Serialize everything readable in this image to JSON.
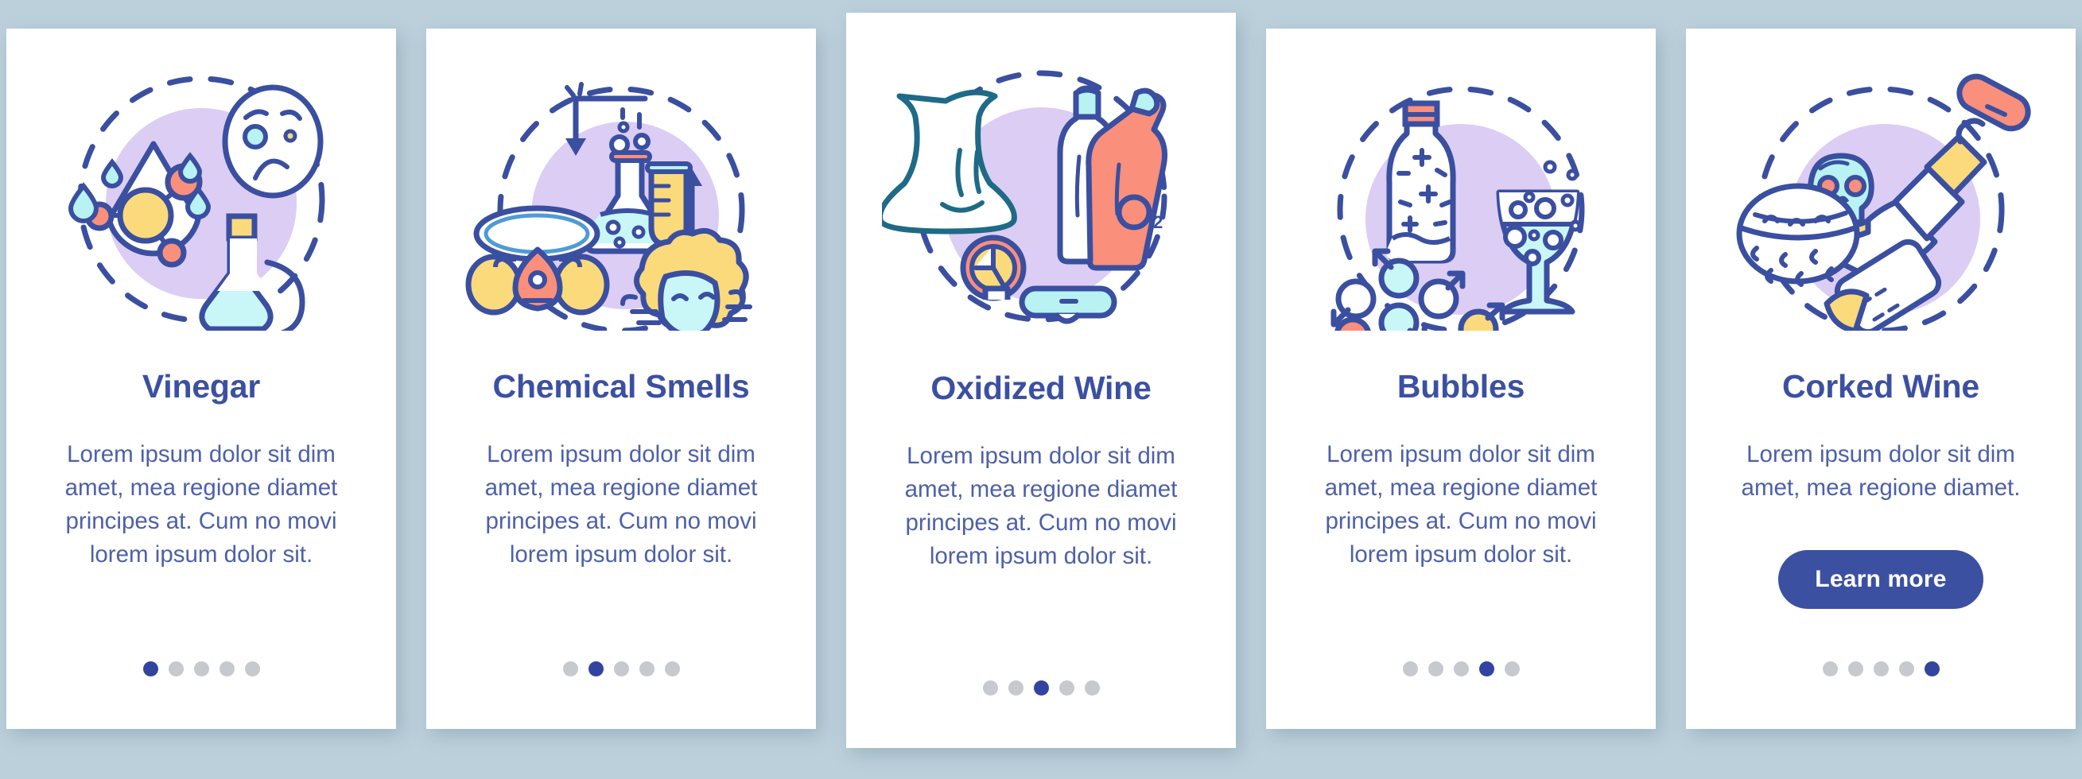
{
  "theme": {
    "background": "#bcd0dc",
    "card_background": "#ffffff",
    "title_color": "#3c50a2",
    "body_color": "#4d60a8",
    "accent": "#3c50a2",
    "dot_inactive": "#c6c9ce",
    "dot_active": "#3343a0",
    "illustration_circle": "#dccdf5",
    "outline": "#3a4fa0",
    "mint": "#b8f2f2",
    "yellow": "#fada7a",
    "coral": "#fa8f7c"
  },
  "cards": [
    {
      "id": "vinegar",
      "title": "Vinegar",
      "body": "Lorem ipsum dolor sit dim amet, mea regione diamet principes at. Cum no movi lorem ipsum dolor sit.",
      "illustration_name": "vinegar-illustration",
      "illustration_elements": [
        "water-drop-molecule-icon",
        "sad-face-icon",
        "vinegar-cruet-icon",
        "droplets-icon"
      ],
      "active_dot": 0,
      "has_button": false
    },
    {
      "id": "chemical-smells",
      "title": "Chemical Smells",
      "body": "Lorem ipsum dolor sit dim amet, mea regione diamet principes at. Cum no movi lorem ipsum dolor sit.",
      "illustration_name": "chemical-smells-illustration",
      "illustration_elements": [
        "respirator-mask-icon",
        "flask-icon",
        "test-tube-icon",
        "sneezing-person-icon",
        "arrow-icon"
      ],
      "active_dot": 1,
      "has_button": false
    },
    {
      "id": "oxidized-wine",
      "title": "Oxidized Wine",
      "body": "Lorem ipsum dolor sit dim amet, mea regione diamet principes at. Cum no movi lorem ipsum dolor sit.",
      "illustration_name": "oxidized-wine-illustration",
      "illustration_elements": [
        "decanter-icon",
        "clock-icon",
        "wine-bottle-icon",
        "o2-bottle-icon",
        "corkscrew-icon"
      ],
      "o2_label": "O",
      "o2_sub": "2",
      "active_dot": 2,
      "has_button": false
    },
    {
      "id": "bubbles",
      "title": "Bubbles",
      "body": "Lorem ipsum dolor sit dim amet, mea regione diamet principes at. Cum no movi lorem ipsum dolor sit.",
      "illustration_name": "bubbles-illustration",
      "illustration_elements": [
        "sparkling-bottle-icon",
        "wine-glass-bubbles-icon",
        "molecule-arrows-icon"
      ],
      "active_dot": 3,
      "has_button": false
    },
    {
      "id": "corked-wine",
      "title": "Corked Wine",
      "body": "Lorem ipsum dolor sit dim amet, mea regione diamet.",
      "illustration_name": "corked-wine-illustration",
      "illustration_elements": [
        "corkscrew-icon",
        "skull-icon",
        "mold-dish-icon",
        "cork-icon",
        "wine-bottle-icon"
      ],
      "active_dot": 4,
      "has_button": true,
      "button_label": "Learn more"
    }
  ],
  "dots_count": 5
}
